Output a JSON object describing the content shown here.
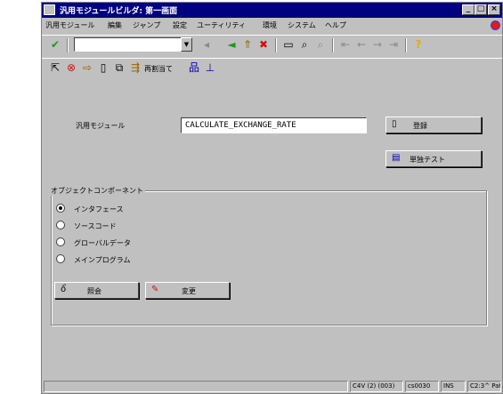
{
  "window": {
    "title": "汎用モジュールビルダ: 第一画面",
    "controls": {
      "minimize": "_",
      "maximize": "□",
      "close": "×"
    }
  },
  "menubar": {
    "items": [
      "汎用モジュール",
      "編集",
      "ジャンプ",
      "設定",
      "ユーティリティ",
      "環境",
      "システム",
      "ヘルプ"
    ]
  },
  "toolbar": {
    "check_icon": "✔",
    "command_field": {
      "value": "",
      "placeholder": ""
    },
    "dropdown_icon": "▼",
    "icons": {
      "back": "◄",
      "exit": "⇑",
      "cancel": "✖",
      "print": "▭",
      "find": "⌕",
      "find_next": "⌕",
      "first_page": "⇤",
      "prev_page": "←",
      "next_page": "→",
      "last_page": "⇥",
      "help": "?"
    }
  },
  "app_toolbar": {
    "icons": [
      "⇱",
      "⊗",
      "⇨",
      "▯",
      "⧉",
      "⇶"
    ],
    "reassign_label": "再割当て",
    "extra_icons": [
      "品",
      "⊥"
    ]
  },
  "form": {
    "fm_label": "汎用モジュール",
    "fm_value": "CALCULATE_EXCHANGE_RATE",
    "create_button": {
      "icon": "▯",
      "label": "登録"
    },
    "test_button": {
      "icon": "▤",
      "label": "単独テスト"
    }
  },
  "object_components": {
    "title": "オブジェクトコンポーネント",
    "options": [
      {
        "label": "インタフェース",
        "selected": true
      },
      {
        "label": "ソースコード",
        "selected": false
      },
      {
        "label": "グローバルデータ",
        "selected": false
      },
      {
        "label": "メインプログラム",
        "selected": false
      }
    ],
    "display_button": {
      "icon": "ổ",
      "label": "照会"
    },
    "change_button": {
      "icon": "✎",
      "label": "変更"
    }
  },
  "statusbar": {
    "system": "C4V (2) (003)",
    "server": "cs0030",
    "mode": "INS",
    "misc": "C2:3^ Pat"
  },
  "colors": {
    "titlebar": "#000080",
    "window_bg": "#c0c0c0",
    "check_green": "#1a9a1a",
    "cancel_red": "#d01010",
    "help_yellow": "#d8b000",
    "pencil_red": "#d01010"
  }
}
